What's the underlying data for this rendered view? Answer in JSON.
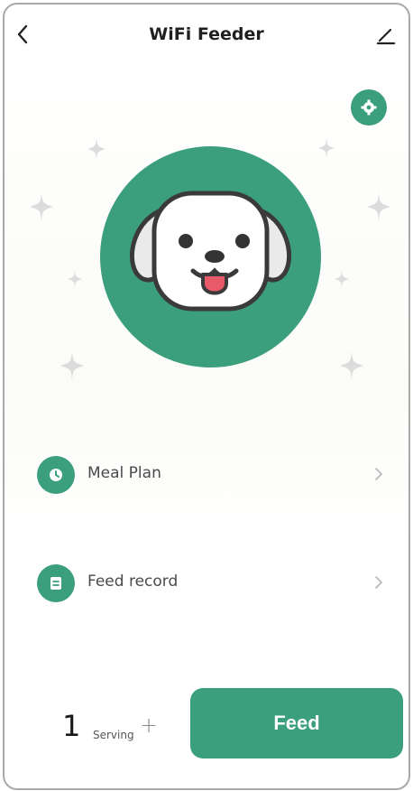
{
  "app": {
    "title": "WiFi Feeder"
  },
  "icons": {
    "back": "chevron-left",
    "edit": "pencil",
    "settings": "gear",
    "meal_plan": "clock",
    "feed_record": "list-document",
    "hero": "dog-face",
    "chevron": "chevron-right"
  },
  "menu": {
    "items": [
      {
        "label": "Meal Plan"
      },
      {
        "label": "Feed record"
      }
    ]
  },
  "serving": {
    "count": "1",
    "unit": "Serving",
    "plus": "+"
  },
  "feed_button": {
    "label": "Feed"
  },
  "colors": {
    "accent": "#3b9f7e",
    "tongue": "#e85a6a",
    "sparkle": "#dadada"
  }
}
